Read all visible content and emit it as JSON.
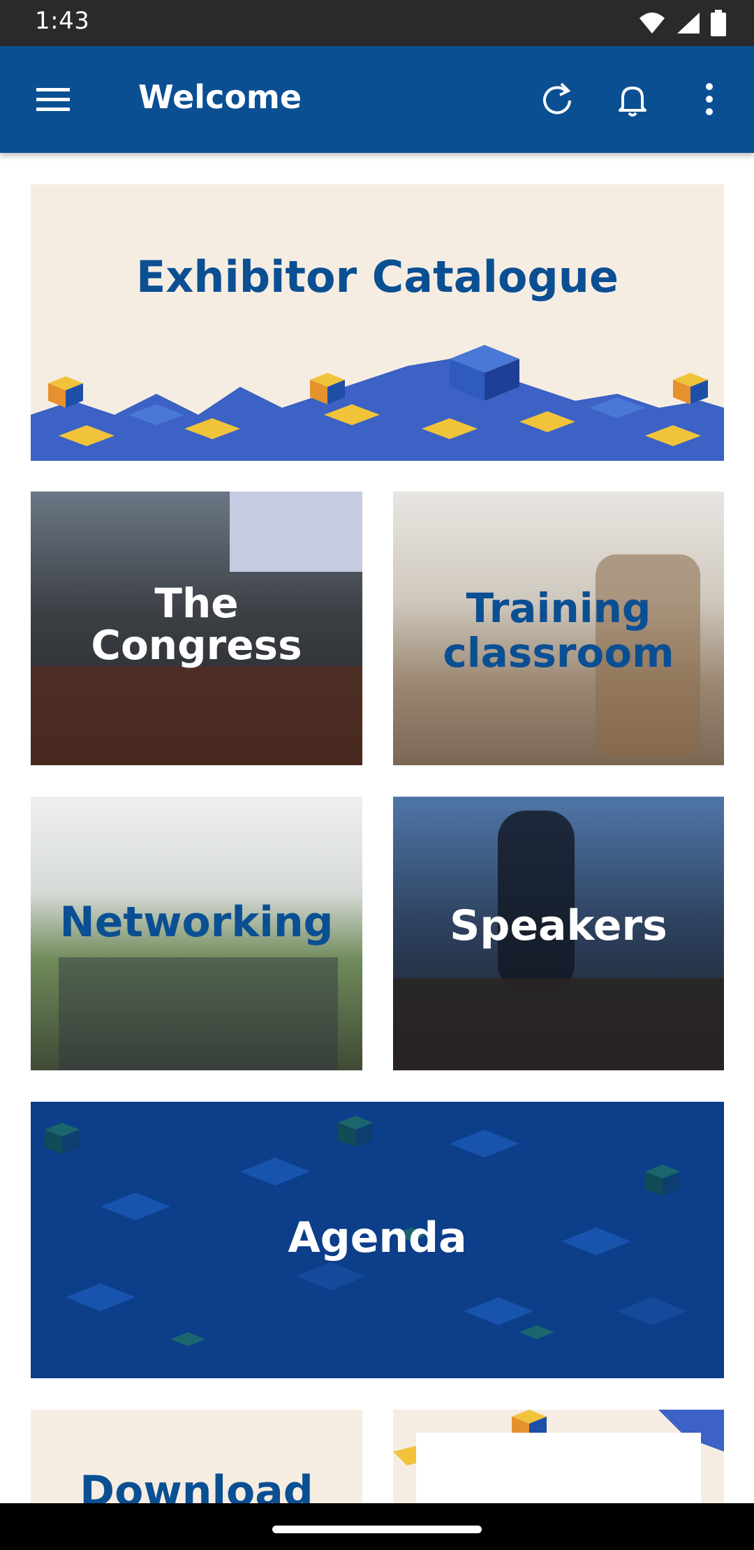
{
  "status_bar": {
    "time": "1:43"
  },
  "app_bar": {
    "title": "Welcome"
  },
  "tiles": {
    "exhibitor": "Exhibitor Catalogue",
    "congress": "The Congress",
    "training": "Training classroom",
    "networking": "Networking",
    "speakers": "Speakers",
    "agenda": "Agenda",
    "download": "Download"
  },
  "icons": [
    "wifi-icon",
    "signal-icon",
    "battery-icon",
    "menu-icon",
    "refresh-icon",
    "bell-icon",
    "more-vert-icon"
  ],
  "colors": {
    "app_bar": "#0b4f93",
    "brand_text": "#0b4f93",
    "cream": "#f6ede2",
    "agenda_bg": "#0c3e8a"
  }
}
